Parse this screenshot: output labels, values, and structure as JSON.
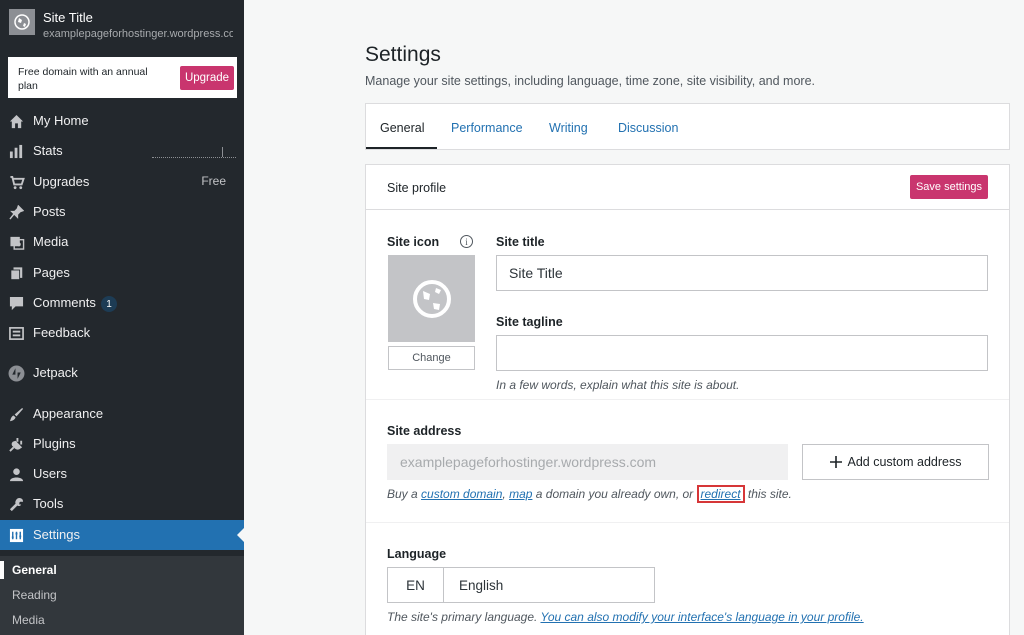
{
  "sidebar": {
    "site_name": "Site Title",
    "site_url": "examplepageforhostinger.wordpress.com",
    "upgrade_text": "Free domain with an annual plan",
    "upgrade_button": "Upgrade",
    "items": [
      {
        "label": "My Home",
        "icon": "home-icon"
      },
      {
        "label": "Stats",
        "icon": "stats-icon"
      },
      {
        "label": "Upgrades",
        "icon": "cart-icon",
        "extra": "Free"
      },
      {
        "label": "Posts",
        "icon": "pin-icon"
      },
      {
        "label": "Media",
        "icon": "media-icon"
      },
      {
        "label": "Pages",
        "icon": "pages-icon"
      },
      {
        "label": "Comments",
        "icon": "comments-icon",
        "badge": "1"
      },
      {
        "label": "Feedback",
        "icon": "feedback-icon"
      },
      {
        "label": "Jetpack",
        "icon": "jetpack-icon"
      },
      {
        "label": "Appearance",
        "icon": "brush-icon"
      },
      {
        "label": "Plugins",
        "icon": "plug-icon"
      },
      {
        "label": "Users",
        "icon": "user-icon"
      },
      {
        "label": "Tools",
        "icon": "wrench-icon"
      },
      {
        "label": "Settings",
        "icon": "settings-icon"
      }
    ],
    "sub_items": [
      "General",
      "Reading",
      "Media"
    ],
    "active_color": "#2271b1"
  },
  "main": {
    "title": "Settings",
    "description": "Manage your site settings, including language, time zone, site visibility, and more.",
    "tabs": [
      "General",
      "Performance",
      "Writing",
      "Discussion"
    ],
    "card_title": "Site profile",
    "save_button": "Save settings",
    "site_icon_label": "Site icon",
    "info_glyph": "i",
    "change_button": "Change",
    "site_title_label": "Site title",
    "site_title_value": "Site Title",
    "tagline_label": "Site tagline",
    "tagline_value": "",
    "tagline_help": "In a few words, explain what this site is about.",
    "address_label": "Site address",
    "address_value": "examplepageforhostinger.wordpress.com",
    "add_address_button": "Add custom address",
    "address_help": {
      "prefix": "Buy a ",
      "link1": "custom domain",
      "sep1": ", ",
      "link2": "map",
      "mid": " a domain you already own, or ",
      "link3": "redirect",
      "suffix": " this site."
    },
    "language_label": "Language",
    "language_code": "EN",
    "language_name": "English",
    "language_help": {
      "prefix": "The site's primary language. ",
      "link": "You can also modify your interface's language in your profile."
    },
    "accent_color": "#c9356e"
  }
}
